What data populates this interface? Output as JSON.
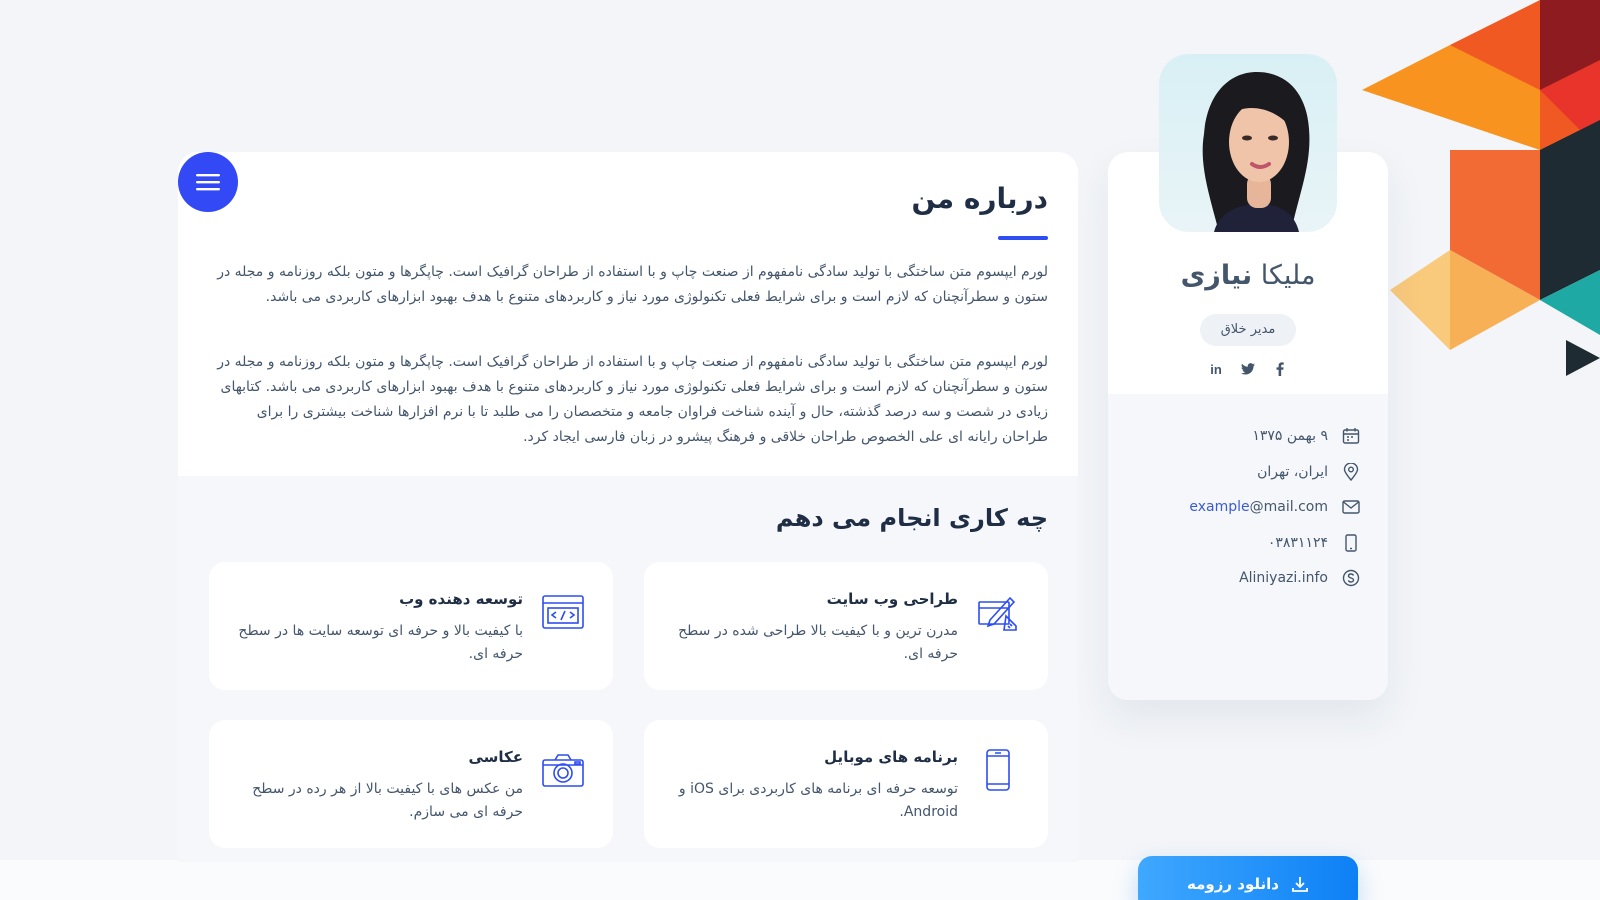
{
  "colors": {
    "accent": "#2e4df2",
    "menu_button": "#3249f5",
    "download_gradient": [
      "#3fa8ff",
      "#0d80f5"
    ],
    "text": "#44566c",
    "heading": "#1f2e44",
    "background": "#f3f5f8"
  },
  "menu_button": {
    "icon": "hamburger-menu-icon"
  },
  "profile": {
    "first_name": "ملیکا",
    "last_name": "نیازی",
    "role": "مدیر خلاق",
    "socials": [
      {
        "icon": "linkedin-icon",
        "label": "in"
      },
      {
        "icon": "twitter-icon"
      },
      {
        "icon": "facebook-icon"
      }
    ],
    "info": {
      "birthday": "۹ بهمن ۱۳۷۵",
      "location": "ایران، تهران",
      "email_user": "example",
      "email_domain": "@mail.com",
      "phone": "۰۳۸۳۱۱۲۴",
      "website": "Aliniyazi.info"
    },
    "download_label": "دانلود رزومه"
  },
  "about": {
    "title": "درباره من",
    "paragraph1": "لورم ایپسوم متن ساختگی با تولید سادگی نامفهوم از صنعت چاپ و با استفاده از طراحان گرافیک است. چاپگرها و متون بلکه روزنامه و مجله در ستون و سطرآنچنان که لازم است و برای شرایط فعلی تکنولوژی مورد نیاز و کاربردهای متنوع با هدف بهبود ابزارهای کاربردی می باشد.",
    "paragraph2": "لورم ایپسوم متن ساختگی با تولید سادگی نامفهوم از صنعت چاپ و با استفاده از طراحان گرافیک است. چاپگرها و متون بلکه روزنامه و مجله در ستون و سطرآنچنان که لازم است و برای شرایط فعلی تکنولوژی مورد نیاز و کاربردهای متنوع با هدف بهبود ابزارهای کاربردی می باشد. کتابهای زیادی در شصت و سه درصد گذشته، حال و آینده شناخت فراوان جامعه و متخصصان را می طلبد تا با نرم افزارها شناخت بیشتری را برای طراحان رایانه ای علی الخصوص طراحان خلاقی و فرهنگ پیشرو در زبان فارسی ایجاد کرد."
  },
  "services": {
    "title": "چه کاری انجام می دهم",
    "items": [
      {
        "icon": "web-design-icon",
        "title": "طراحی وب سایت",
        "desc": "مدرن ترین و با کیفیت بالا طراحی شده در سطح حرفه ای."
      },
      {
        "icon": "code-window-icon",
        "title": "توسعه دهنده وب",
        "desc": "با کیفیت بالا و حرفه ای توسعه سایت ها در سطح حرفه ای."
      },
      {
        "icon": "mobile-phone-icon",
        "title": "برنامه های موبایل",
        "desc": "توسعه حرفه ای برنامه های کاربردی برای iOS و Android."
      },
      {
        "icon": "camera-icon",
        "title": "عکاسی",
        "desc": "من عکس های با کیفیت بالا از هر رده در سطح حرفه ای می سازم."
      }
    ]
  }
}
